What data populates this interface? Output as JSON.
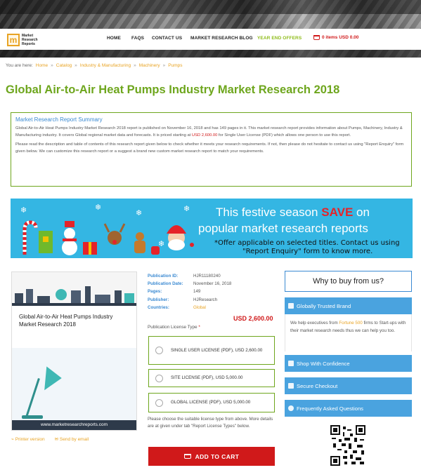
{
  "header": {
    "logo_text": "Market Research Reports",
    "logo_mark": "m",
    "nav": [
      "HOME",
      "FAQS",
      "CONTACT US",
      "MARKET RESEARCH BLOG",
      "YEAR END OFFERS"
    ],
    "cart_text": "0 items USD 0.00",
    "cart_icon": "cart-icon"
  },
  "breadcrumb": {
    "prefix": "You are here:",
    "items": [
      "Home",
      "Catalog",
      "Industry & Manufacturing",
      "Machinery",
      "Pumps"
    ],
    "separator": "»"
  },
  "title": "Global Air-to-Air Heat Pumps Industry Market Research 2018",
  "summary": {
    "heading": "Market Research Report Summary",
    "p1_before": "Global Air-to-Air Heat Pumps Industry Market Research 2018 report is published on November 16, 2018 and has 149 pages in it. This market research report provides information about Pumps, Machinery, Industry & Manufacturing industry. It covers Global regional market data and forecasts. It is priced starting at ",
    "p1_price": "USD 2,600.00",
    "p1_after": " for Single User License (PDF) which allows one person to use this report.",
    "p2": "Please read the description and table of contents of this research report given below to check whether it meets your research requirements. If not, then please do not hesitate to contact us using \"Report Enquiry\" form given below. We can customize this research report or a suggest a brand new custom market research report to match your requirements."
  },
  "banner": {
    "line1_before": "This festive season ",
    "line1_save": "SAVE",
    "line1_after": " on",
    "line2": "popular market research reports",
    "note1": "*Offer applicable on selected titles. Contact us using",
    "note2": "\"Report Enquiry\" form to know more."
  },
  "cover": {
    "title": "Global Air-to-Air Heat Pumps Industry Market Research 2018",
    "url": "www.marketresearchreports.com"
  },
  "links": {
    "printer": "Printer version",
    "email": "Send by email"
  },
  "details": {
    "rows": [
      {
        "label": "Publication ID:",
        "value": "HJR11180240"
      },
      {
        "label": "Publication Date:",
        "value": "November 16, 2018"
      },
      {
        "label": "Pages:",
        "value": "149"
      },
      {
        "label": "Publisher:",
        "value": "HJResearch"
      },
      {
        "label": "Countries:",
        "value": "Global"
      }
    ],
    "price": "USD 2,600.00",
    "license_label": "Publication License Type",
    "license_required": "*",
    "licenses": [
      "SINGLE USER LICENSE (PDF), USD 2,600.00",
      "SITE LICENSE (PDF), USD 5,000.00",
      "GLOBAL LICENSE (PDF), USD 5,000.00"
    ],
    "license_note": "Please choose the suitable license type from above. More details are at given under tab \"Report License Types\" below.",
    "add_to_cart": "ADD TO CART"
  },
  "sidebar": {
    "why_title": "Why to buy from us?",
    "trusted": "Globally Trusted Brand",
    "trust_before": "We help executives from ",
    "trust_f500": "Fortune 500",
    "trust_after": " firms to Start-ups with their market research needs thus we can help you too.",
    "shop": "Shop With Confidence",
    "secure": "Secure Checkout",
    "faq": "Frequently Asked Questions"
  },
  "colors": {
    "brand_green": "#6ea61d",
    "accent_orange": "#e8a323",
    "price_red": "#d0191a",
    "info_blue": "#4aa3df",
    "banner_blue": "#34b6e3"
  }
}
